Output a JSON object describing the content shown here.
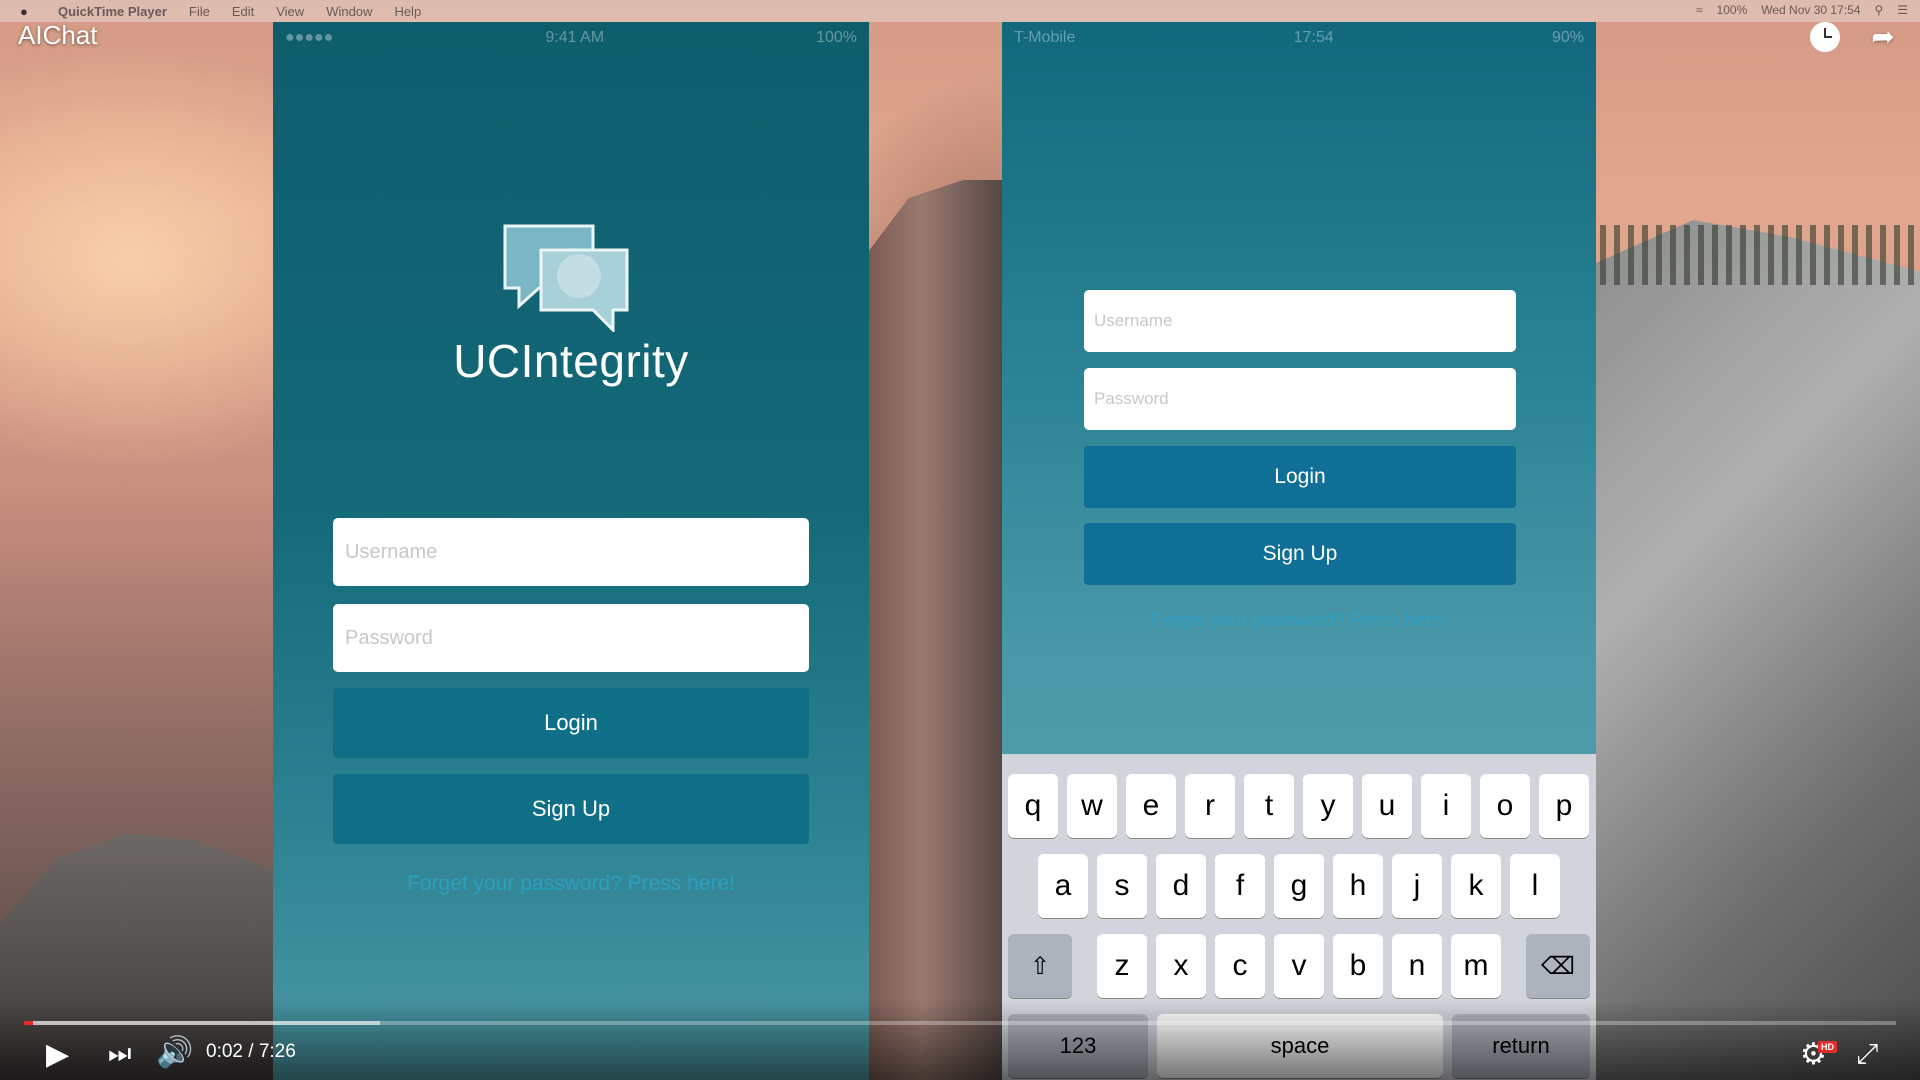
{
  "menubar": {
    "app_name": "QuickTime Player",
    "items": [
      "File",
      "Edit",
      "View",
      "Window",
      "Help"
    ],
    "battery": "100%",
    "clock": "Wed Nov 30  17:54"
  },
  "video": {
    "title": "AIChat",
    "watch_later_icon": "clock-icon",
    "share_icon": "share-arrow-icon"
  },
  "phone1": {
    "status_time": "9:41 AM",
    "status_battery": "100%",
    "brand": "UCIntegrity",
    "username_placeholder": "Username",
    "password_placeholder": "Password",
    "login_label": "Login",
    "signup_label": "Sign Up",
    "forgot_text": "Forget your password? Press here!"
  },
  "phone2": {
    "status_carrier": "T-Mobile",
    "status_time": "17:54",
    "status_battery": "90%",
    "username_placeholder": "Username",
    "password_placeholder": "Password",
    "login_label": "Login",
    "signup_label": "Sign Up",
    "forgot_text": "Forget your password? Press here!",
    "keyboard": {
      "row1": [
        "q",
        "w",
        "e",
        "r",
        "t",
        "y",
        "u",
        "i",
        "o",
        "p"
      ],
      "row2": [
        "a",
        "s",
        "d",
        "f",
        "g",
        "h",
        "j",
        "k",
        "l"
      ],
      "row3": [
        "z",
        "x",
        "c",
        "v",
        "b",
        "n",
        "m"
      ],
      "numbers_label": "123",
      "space_label": "space",
      "return_label": "return"
    }
  },
  "player": {
    "current_time": "0:02",
    "duration": "7:26",
    "time_text": "0:02 / 7:26",
    "played_fraction": 0.005,
    "buffered_fraction": 0.19,
    "hd_label": "HD",
    "accent_color": "#e52d27"
  }
}
